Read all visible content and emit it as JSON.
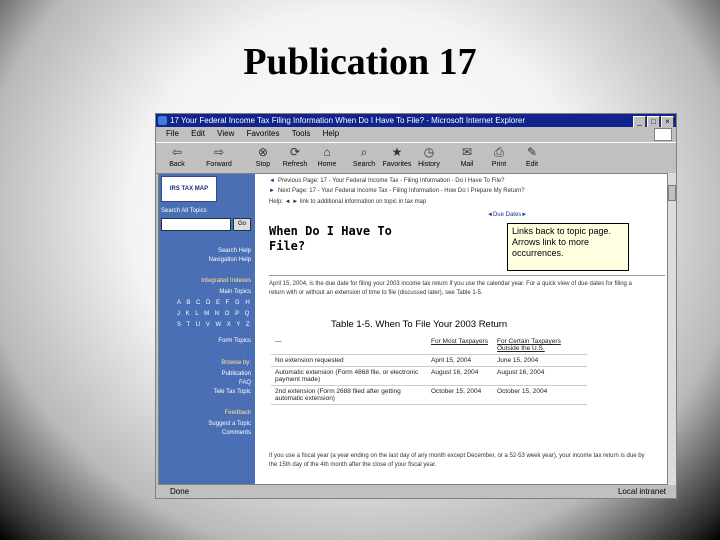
{
  "slide": {
    "title": "Publication 17"
  },
  "window": {
    "title": "17 Your Federal Income Tax Filing Information When Do I Have To File? - Microsoft Internet Explorer",
    "controls": [
      "_",
      "□",
      "×"
    ]
  },
  "menu": [
    "File",
    "Edit",
    "View",
    "Favorites",
    "Tools",
    "Help"
  ],
  "toolbar": [
    {
      "label": "Back",
      "icon": "back-arrow-icon",
      "glyph": "⇦"
    },
    {
      "label": "Forward",
      "icon": "forward-arrow-icon",
      "glyph": "⇨"
    },
    {
      "label": "Stop",
      "icon": "stop-icon",
      "glyph": "⊗"
    },
    {
      "label": "Refresh",
      "icon": "refresh-icon",
      "glyph": "⟳"
    },
    {
      "label": "Home",
      "icon": "home-icon",
      "glyph": "⌂"
    },
    {
      "label": "Search",
      "icon": "search-icon",
      "glyph": "⌕"
    },
    {
      "label": "Favorites",
      "icon": "favorites-icon",
      "glyph": "★"
    },
    {
      "label": "History",
      "icon": "history-icon",
      "glyph": "◷"
    },
    {
      "label": "Mail",
      "icon": "mail-icon",
      "glyph": "✉"
    },
    {
      "label": "Print",
      "icon": "print-icon",
      "glyph": "⎙"
    },
    {
      "label": "Edit",
      "icon": "edit-icon",
      "glyph": "✎"
    }
  ],
  "sidebar": {
    "logo": "IRS TAX MAP",
    "search_label": "Search All Topics",
    "go": "Go",
    "links_top": [
      "Search Help",
      "Navigation Help"
    ],
    "integrated_indexes": "Integrated Indexes",
    "main_topics": "Main Topics",
    "alpha_rows": [
      "A B C D E F G H I",
      "J K L M N O P Q R",
      "S T U V W X Y Z #"
    ],
    "form_topics": "Form Topics",
    "browse_by": "Browse by:",
    "browse_links": [
      "Publication",
      "FAQ",
      "Tele Tax Topic"
    ],
    "feedback": "Feedback",
    "feedback_links": [
      "Suggest a Topic",
      "Comments"
    ]
  },
  "nav": {
    "previous": "Previous Page: 17 - Your Federal Income Tax - Filing Information - Do I Have To File?",
    "next": "Next Page: 17 - Your Federal Income Tax - Filing Information - How Do I Prepare My Return?",
    "help": "Help: ◄ ► link to additional information on topic in tax map"
  },
  "heading": "When Do I Have To File?",
  "due_dates": "◄Due Dates►",
  "callout": "Links back to topic page. Arrows link to more occurrences.",
  "para1": "April 15, 2004, is the due date for filing your 2003 income tax return if you use the calendar year. For a quick view of due dates for filing a return with or without an extension of time to file (discussed later), see Table 1-5.",
  "table": {
    "title": "Table 1-5.  When To File Your 2003 Return",
    "headers": [
      "—",
      "For Most Taxpayers",
      "For Certain Taxpayers Outside the U.S."
    ],
    "rows": [
      [
        "No extension requested",
        "April 15, 2004",
        "June 15, 2004"
      ],
      [
        "Automatic extension (Form 4868 file, or electronic payment made)",
        "August 16, 2004",
        "August 16, 2004"
      ],
      [
        "2nd extension (Form 2688 filed after getting automatic extension)",
        "October 15, 2004",
        "October 15, 2004"
      ]
    ]
  },
  "para2": "If you use a fiscal year (a year ending on the last day of any month except December, or a 52-53 week year), your income tax return is due by the 15th day of the 4th month after the close of your fiscal year.",
  "status": {
    "text": "Done",
    "zone": "Local intranet"
  }
}
